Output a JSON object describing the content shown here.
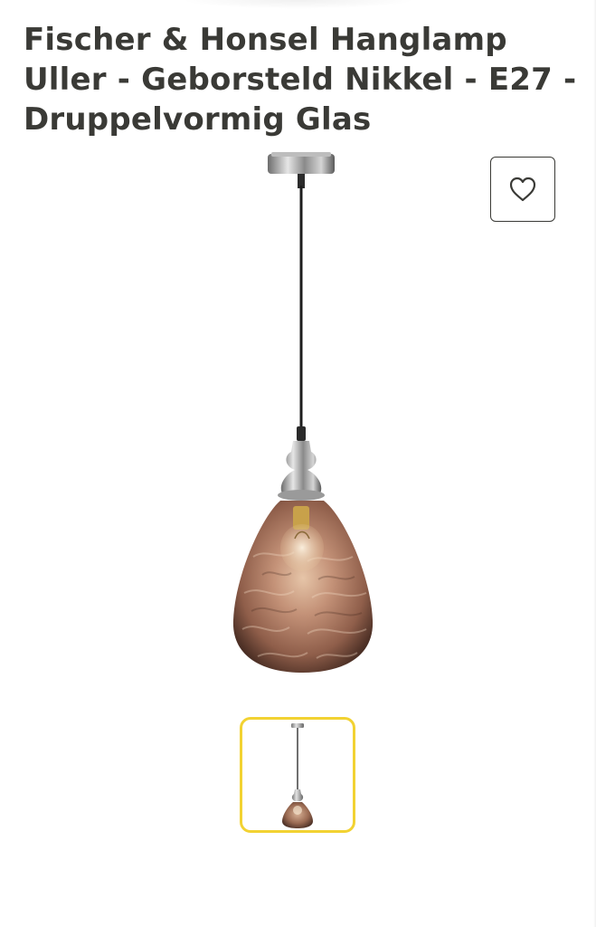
{
  "product": {
    "title_lines": [
      "Fischer & Honsel Hanglamp",
      "Uller - Geborsteld Nikkel - E27 -",
      "Druppelvormig Glas"
    ]
  },
  "favorite": {
    "icon": "heart-icon"
  },
  "gallery": {
    "main_image": "pendant-lamp-image",
    "thumbnails": [
      {
        "icon": "pendant-lamp-thumbnail",
        "selected": true
      }
    ]
  },
  "colors": {
    "text": "#3a3a36",
    "thumb_selected_border": "#f2d232",
    "glass": "#b98a6f"
  }
}
